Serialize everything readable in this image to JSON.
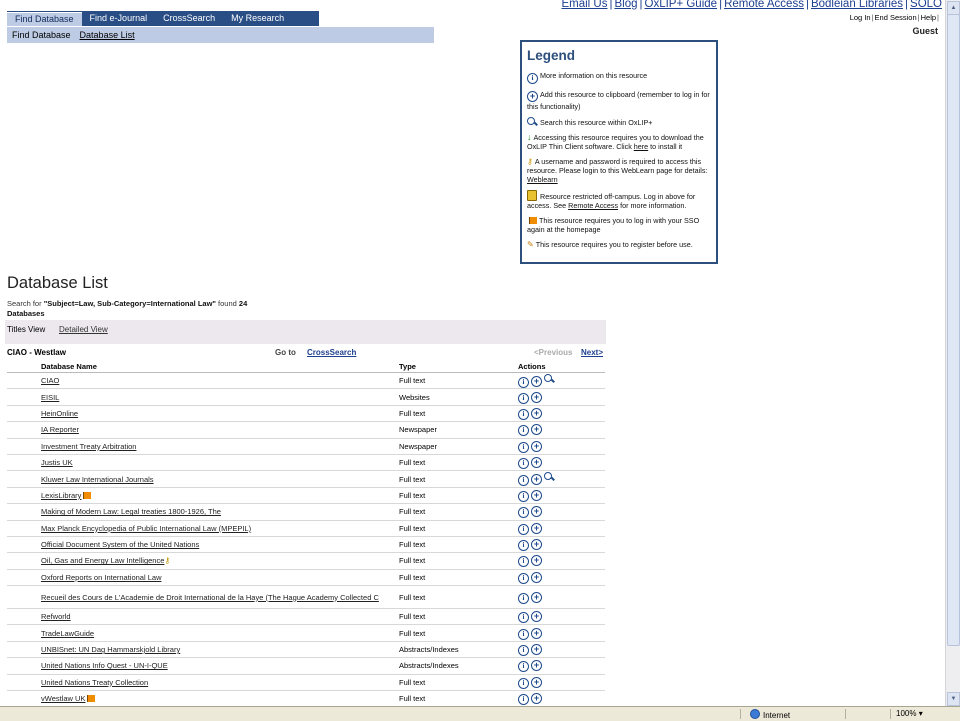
{
  "top_links": [
    "Email Us",
    "Blog",
    "OxLIP+ Guide",
    "Remote Access",
    "Bodleian Libraries",
    "SOLO"
  ],
  "tabs": [
    "Find Database",
    "Find e-Journal",
    "CrossSearch",
    "My Research"
  ],
  "subnav": {
    "current": "Find Database",
    "link": "Database List"
  },
  "session": {
    "login": "Log In",
    "end": "End Session",
    "help": "Help",
    "user": "Guest"
  },
  "legend": {
    "title": "Legend",
    "more_info": "More information on this resource",
    "clipboard": "Add this resource to clipboard (remember to log in for this functionality)",
    "search": "Search this resource within OxLIP+",
    "client_pre": "Accessing this resource requires you to download the OxLIP Thin Client software. Click ",
    "client_link": "here",
    "client_post": " to install it",
    "password_pre": "A username and password is required to access this resource. Please login to this WebLearn page for details: ",
    "password_link": "Weblearn",
    "restricted_pre": "Resource restricted off-campus. Log in above for access. See ",
    "restricted_link": "Remote Access",
    "restricted_post": " for more information.",
    "sso": "This resource requires you to log in with your SSO again at the homepage",
    "register": "This resource requires you to register before use."
  },
  "page_title": "Database List",
  "search_summary": {
    "prefix": "Search for ",
    "query": "\"Subject=Law, Sub-Category=International Law\"",
    "found": " found ",
    "count": "24",
    "suffix": "Databases"
  },
  "views": {
    "titles": "Titles View",
    "detailed": "Detailed View"
  },
  "nav": {
    "range": "CIAO - Westlaw",
    "goto": "Go to",
    "crosssearch": "CrossSearch",
    "previous": "<Previous",
    "next": "Next>"
  },
  "table": {
    "headers": {
      "name": "Database Name",
      "type": "Type",
      "actions": "Actions"
    },
    "rows": [
      {
        "name": "CIAO",
        "type": "Full text",
        "icons": [
          "info",
          "add",
          "search"
        ]
      },
      {
        "name": "EISIL",
        "type": "Websites",
        "icons": [
          "info",
          "add"
        ]
      },
      {
        "name": "HeinOnline",
        "type": "Full text",
        "icons": [
          "info",
          "add"
        ]
      },
      {
        "name": "IA Reporter",
        "type": "Newspaper",
        "icons": [
          "info",
          "add"
        ]
      },
      {
        "name": "Investment Treaty Arbitration",
        "type": "Newspaper",
        "icons": [
          "info",
          "add"
        ]
      },
      {
        "name": "Justis UK",
        "type": "Full text",
        "icons": [
          "info",
          "add"
        ]
      },
      {
        "name": "Kluwer Law International Journals",
        "type": "Full text",
        "icons": [
          "info",
          "add",
          "search"
        ]
      },
      {
        "name": "LexisLibrary",
        "type": "Full text",
        "icons": [
          "info",
          "add"
        ],
        "badge": "flag"
      },
      {
        "name": "Making of Modern Law: Legal treaties 1800-1926, The",
        "type": "Full text",
        "icons": [
          "info",
          "add"
        ]
      },
      {
        "name": "Max Planck Encyclopedia of Public International Law (MPEPIL)",
        "type": "Full text",
        "icons": [
          "info",
          "add"
        ]
      },
      {
        "name": "Official Document System of the United Nations",
        "type": "Full text",
        "icons": [
          "info",
          "add"
        ]
      },
      {
        "name": "Oil, Gas and Energy Law Intelligence",
        "type": "Full text",
        "icons": [
          "info",
          "add"
        ],
        "badge": "key"
      },
      {
        "name": "Oxford Reports on International Law",
        "type": "Full text",
        "icons": [
          "info",
          "add"
        ]
      },
      {
        "name": "Recueil des Cours de L'Academie de Droit International de la Haye (The Hague Academy Collected C",
        "type": "Full text",
        "icons": [
          "info",
          "add"
        ],
        "tall": true
      },
      {
        "name": "Refworld",
        "type": "Full text",
        "icons": [
          "info",
          "add"
        ]
      },
      {
        "name": "TradeLawGuide",
        "type": "Full text",
        "icons": [
          "info",
          "add"
        ]
      },
      {
        "name": "UNBISnet: UN Dag Hammarskjold Library",
        "type": "Abstracts/Indexes",
        "icons": [
          "info",
          "add"
        ]
      },
      {
        "name": "United Nations Info Quest - UN-I-QUE",
        "type": "Abstracts/Indexes",
        "icons": [
          "info",
          "add"
        ]
      },
      {
        "name": "United Nations Treaty Collection",
        "type": "Full text",
        "icons": [
          "info",
          "add"
        ]
      },
      {
        "name": "vWestlaw UK",
        "type": "Full text",
        "icons": [
          "info",
          "add"
        ],
        "badge": "flag"
      }
    ]
  },
  "statusbar": {
    "zone": "Internet",
    "zoom": "100%"
  }
}
